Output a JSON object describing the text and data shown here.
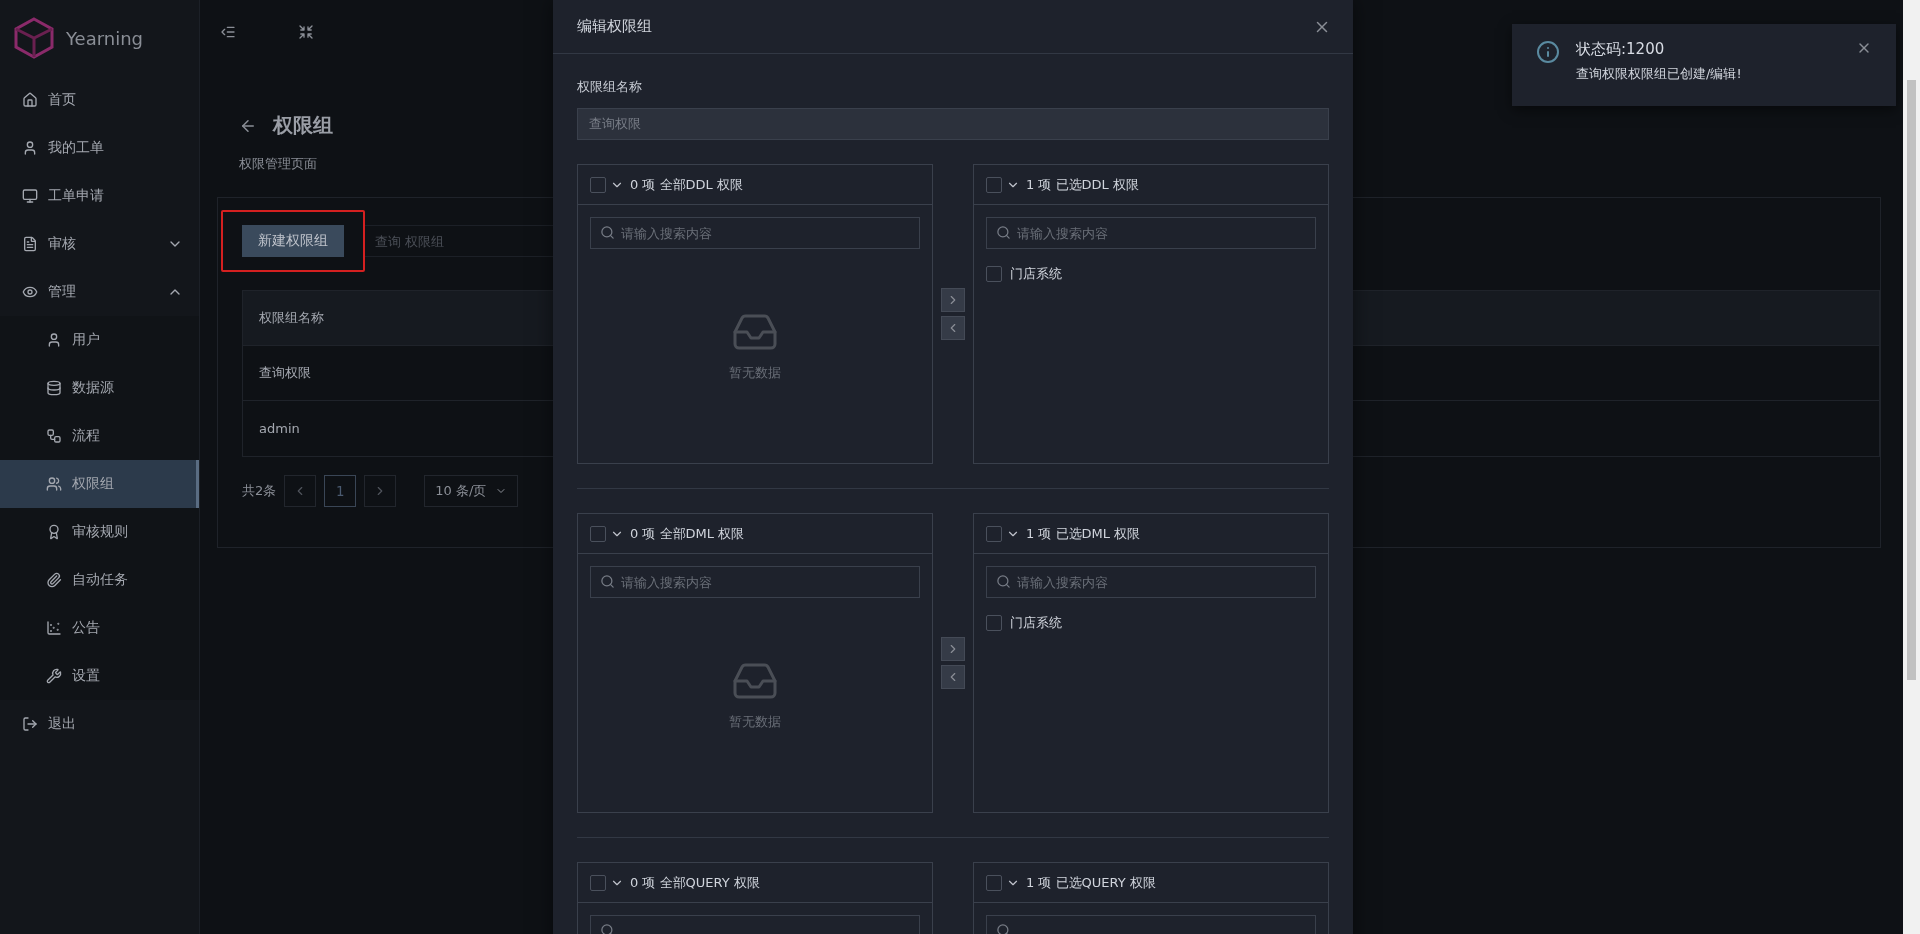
{
  "brand": {
    "name": "Yearning"
  },
  "sidebar": {
    "items": [
      {
        "kind": "link",
        "label": "首页",
        "selected": false
      },
      {
        "kind": "link",
        "label": "我的工单",
        "selected": false
      },
      {
        "kind": "link",
        "label": "工单申请",
        "selected": false
      },
      {
        "kind": "group",
        "label": "审核",
        "selected": false,
        "expanded": false
      },
      {
        "kind": "group",
        "label": "管理",
        "selected": false,
        "expanded": true,
        "children": [
          {
            "label": "用户",
            "selected": false
          },
          {
            "label": "数据源",
            "selected": false
          },
          {
            "label": "流程",
            "selected": false
          },
          {
            "label": "权限组",
            "selected": true
          },
          {
            "label": "审核规则",
            "selected": false
          },
          {
            "label": "自动任务",
            "selected": false
          },
          {
            "label": "公告",
            "selected": false
          },
          {
            "label": "设置",
            "selected": false
          }
        ]
      },
      {
        "kind": "link",
        "label": "退出",
        "selected": false
      }
    ]
  },
  "page": {
    "title": "权限组",
    "subtitle": "权限管理页面",
    "new_button": "新建权限组",
    "search": {
      "placeholder": "查询 权限组"
    },
    "table": {
      "columns": [
        "权限组名称"
      ],
      "rows": [
        [
          "查询权限"
        ],
        [
          "admin"
        ]
      ]
    },
    "pagination": {
      "total": "共2条",
      "pages": [
        {
          "label": "1",
          "selected": true
        }
      ],
      "page_size": "10 条/页"
    }
  },
  "modal": {
    "title": "编辑权限组",
    "field_label": "权限组名称",
    "field_value": "查询权限",
    "sections": [
      {
        "left": {
          "title": "0 项 全部DDL 权限",
          "checked": false,
          "search_placeholder": "请输入搜索内容",
          "empty_text": "暂无数据"
        },
        "right": {
          "title": "1 项 已选DDL 权限",
          "checked": false,
          "search_placeholder": "请输入搜索内容",
          "items": [
            {
              "label": "门店系统",
              "checked": false
            }
          ]
        }
      },
      {
        "left": {
          "title": "0 项 全部DML 权限",
          "checked": false,
          "search_placeholder": "请输入搜索内容",
          "empty_text": "暂无数据"
        },
        "right": {
          "title": "1 项 已选DML 权限",
          "checked": false,
          "search_placeholder": "请输入搜索内容",
          "items": [
            {
              "label": "门店系统",
              "checked": false
            }
          ]
        }
      },
      {
        "left": {
          "title": "0 项 全部QUERY 权限",
          "checked": false
        },
        "right": {
          "title": "1 项 已选QUERY 权限",
          "checked": false
        }
      }
    ]
  },
  "notification": {
    "title": "状态码:1200",
    "message": "查询权限权限组已创建/编辑!"
  }
}
